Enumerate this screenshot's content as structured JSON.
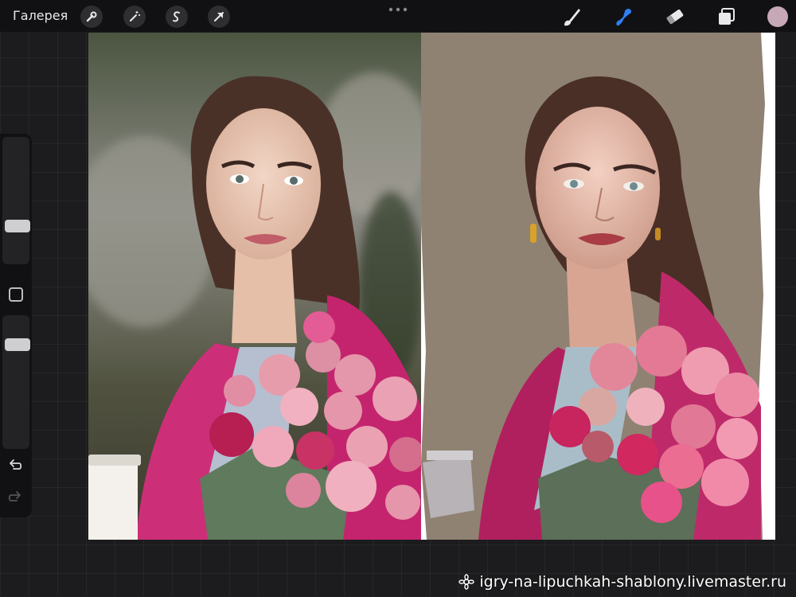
{
  "toolbar": {
    "gallery_label": "Галерея",
    "tools_left": [
      "wrench-icon",
      "magic-wand-icon",
      "selection-s-icon",
      "transform-arrow-icon"
    ],
    "tools_right": [
      "brush-icon",
      "smudge-icon",
      "eraser-icon",
      "layers-icon"
    ],
    "active_tool": "smudge-icon",
    "accent_color": "#2f7ff5",
    "current_color": "#c7a8b6"
  },
  "sidebar": {
    "brush_size_level": 0.72,
    "opacity_level": 0.19,
    "undo_icon": "undo-icon",
    "redo_icon": "redo-icon"
  },
  "watermark": {
    "text": "igry-na-lipuchkah-shablony.livemaster.ru",
    "icon": "gear-flower-icon"
  }
}
